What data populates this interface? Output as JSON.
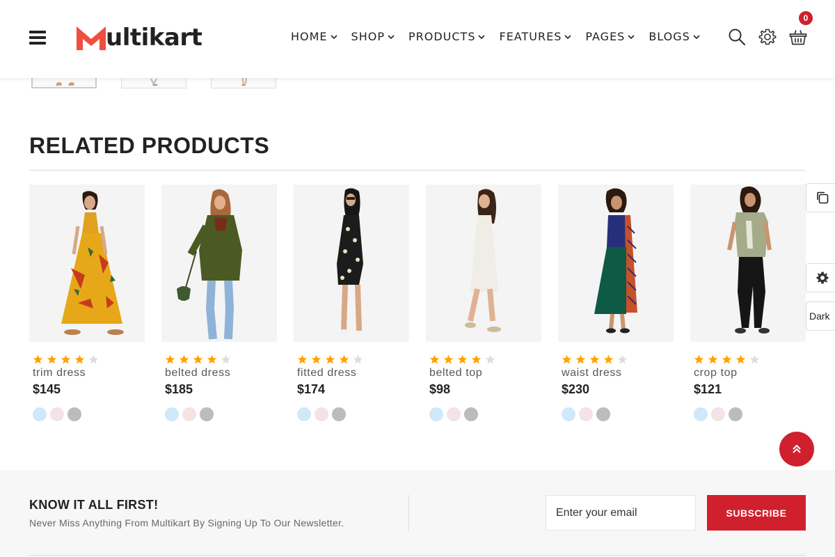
{
  "header": {
    "logo_rest": "ultikart",
    "nav": [
      {
        "label": "HOME"
      },
      {
        "label": "SHOP"
      },
      {
        "label": "PRODUCTS"
      },
      {
        "label": "FEATURES"
      },
      {
        "label": "PAGES"
      },
      {
        "label": "BLOGS"
      }
    ],
    "cart_count": "0",
    "brand_color": "#d0202d",
    "icons": [
      "menu-icon",
      "search-icon",
      "settings-icon",
      "basket-icon"
    ]
  },
  "related": {
    "title": "RELATED PRODUCTS",
    "products": [
      {
        "name": "trim dress",
        "price": "$145",
        "rating": 4
      },
      {
        "name": "belted dress",
        "price": "$185",
        "rating": 4
      },
      {
        "name": "fitted dress",
        "price": "$174",
        "rating": 4
      },
      {
        "name": "belted top",
        "price": "$98",
        "rating": 4
      },
      {
        "name": "waist dress",
        "price": "$230",
        "rating": 4
      },
      {
        "name": "crop top",
        "price": "$121",
        "rating": 4
      }
    ],
    "swatch_colors": [
      "#cfe9fb",
      "#f3e3e4",
      "#bcbcbc"
    ],
    "star_color": "#ffa200",
    "star_empty_color": "#dddddd"
  },
  "side_tools": {
    "dark_label": "Dark"
  },
  "newsletter": {
    "title": "KNOW IT ALL FIRST!",
    "subtitle": "Never Miss Anything From Multikart By Signing Up To Our Newsletter.",
    "email_placeholder": "Enter your email",
    "subscribe_label": "SUBSCRIBE"
  }
}
